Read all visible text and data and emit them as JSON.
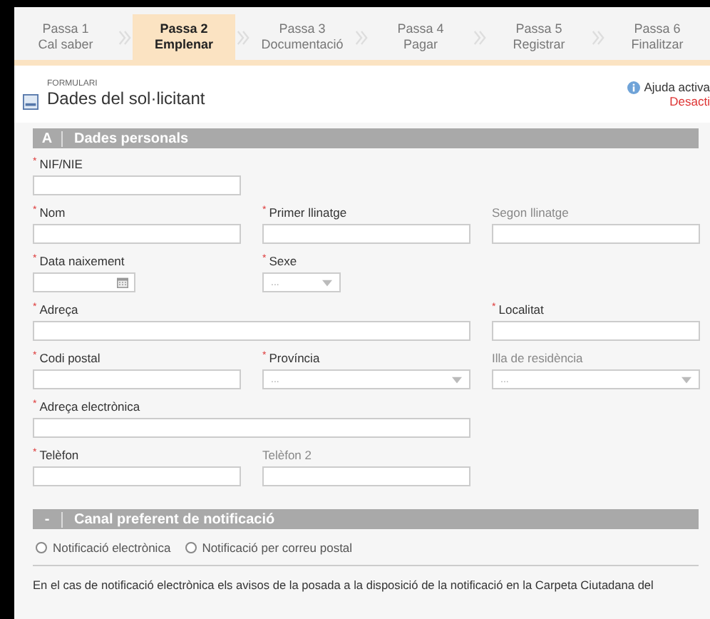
{
  "steps": [
    {
      "number": "Passa 1",
      "label": "Cal saber",
      "selected": false
    },
    {
      "number": "Passa 2",
      "label": "Emplenar",
      "selected": true
    },
    {
      "number": "Passa 3",
      "label": "Documentació",
      "selected": false
    },
    {
      "number": "Passa 4",
      "label": "Pagar",
      "selected": false
    },
    {
      "number": "Passa 5",
      "label": "Registrar",
      "selected": false
    },
    {
      "number": "Passa 6",
      "label": "Finalitzar",
      "selected": false
    }
  ],
  "header": {
    "eyebrow": "FORMULARI",
    "title": "Dades del sol·licitant",
    "help_label": "Ajuda activa",
    "help_action": "Desacti"
  },
  "section_a": {
    "letter": "A",
    "title": "Dades personals"
  },
  "rows": [
    [
      {
        "required_mark": "*",
        "label": "NIF/NIE",
        "kind": "text"
      }
    ],
    [
      {
        "required_mark": "*",
        "label": "Nom",
        "kind": "text"
      },
      {
        "required_mark": "*",
        "label": "Primer llinatge",
        "kind": "text"
      },
      {
        "label": "Segon llinatge",
        "kind": "text"
      }
    ],
    [
      {
        "required_mark": "*",
        "label": "Data naixement",
        "kind": "date"
      },
      {
        "required_mark": "*",
        "label": "Sexe",
        "kind": "short_select",
        "placeholder": "..."
      }
    ],
    [
      {
        "required_mark": "*",
        "label": "Adreça",
        "kind": "wide_text"
      },
      {
        "required_mark": "*",
        "label": "Localitat",
        "kind": "text"
      }
    ],
    [
      {
        "required_mark": "*",
        "label": "Codi postal",
        "kind": "text"
      },
      {
        "required_mark": "*",
        "label": "Província",
        "kind": "select",
        "placeholder": "..."
      },
      {
        "label": "Illa de residència",
        "kind": "select",
        "placeholder": "..."
      }
    ],
    [
      {
        "required_mark": "*",
        "label": "Adreça electrònica",
        "kind": "wide_text"
      }
    ],
    [
      {
        "required_mark": "*",
        "label": "Telèfon",
        "kind": "text"
      },
      {
        "label": "Telèfon 2",
        "kind": "text"
      }
    ]
  ],
  "section_b": {
    "letter": "-",
    "title": "Canal preferent de notificació"
  },
  "channels": [
    {
      "label": "Notificació electrònica",
      "selected": false
    },
    {
      "label": "Notificació per correu postal",
      "selected": false
    }
  ],
  "note": "En el cas de notificació electrònica els avisos de la posada a la disposició de la notificació en la Carpeta Ciutadana del"
}
